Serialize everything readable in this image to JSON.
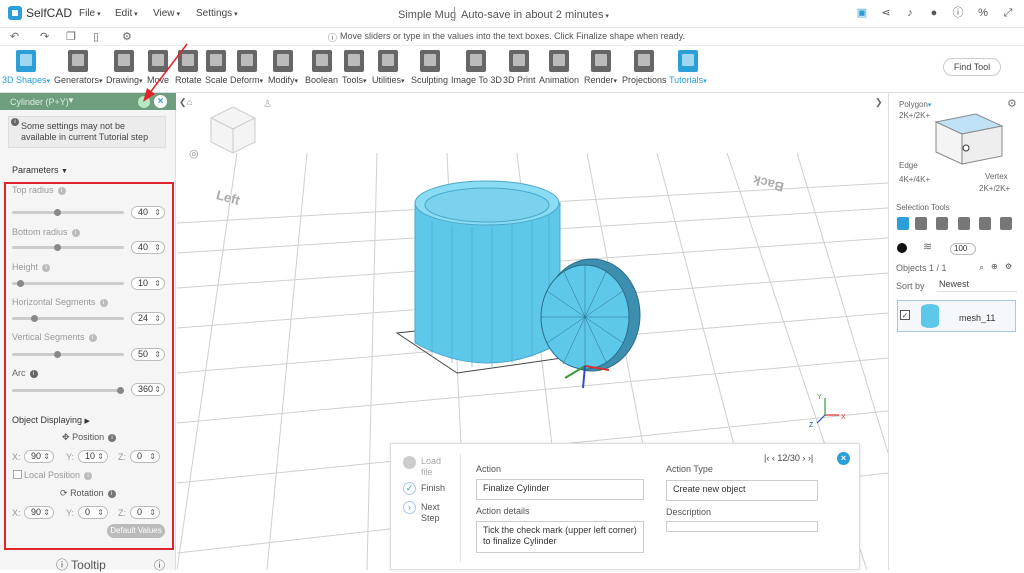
{
  "app": {
    "name": "SelfCAD"
  },
  "menu": [
    "File",
    "Edit",
    "View",
    "Settings"
  ],
  "document": {
    "title": "Simple Mug",
    "autosave": "Auto-save in about 2 minutes"
  },
  "hint": "Move sliders or type in the values into the text boxes. Click Finalize shape when ready.",
  "toolbar": {
    "tools": [
      {
        "label": "3D Shapes"
      },
      {
        "label": "Generators"
      },
      {
        "label": "Drawing"
      },
      {
        "label": "Move"
      },
      {
        "label": "Rotate"
      },
      {
        "label": "Scale"
      },
      {
        "label": "Deform"
      },
      {
        "label": "Modify"
      },
      {
        "label": "Boolean"
      },
      {
        "label": "Tools"
      },
      {
        "label": "Utilities"
      },
      {
        "label": "Sculpting"
      },
      {
        "label": "Image To 3D"
      },
      {
        "label": "3D Print"
      },
      {
        "label": "Animation"
      },
      {
        "label": "Render"
      },
      {
        "label": "Projections"
      },
      {
        "label": "Tutorials"
      }
    ],
    "find_tool": "Find Tool"
  },
  "panel": {
    "title": "Cylinder (P+Y)",
    "warning": "Some settings may not be available in current Tutorial step",
    "parameters_label": "Parameters",
    "params": [
      {
        "label": "Top radius",
        "value": "40",
        "fraction": 0.4
      },
      {
        "label": "Bottom radius",
        "value": "40",
        "fraction": 0.4
      },
      {
        "label": "Height",
        "value": "10",
        "fraction": 0.05
      },
      {
        "label": "Horizontal Segments",
        "value": "24",
        "fraction": 0.18
      },
      {
        "label": "Vertical Segments",
        "value": "50",
        "fraction": 0.4
      },
      {
        "label": "Arc",
        "value": "360",
        "fraction": 1.0
      }
    ],
    "object_displaying": "Object Displaying",
    "position_label": "Position",
    "position": {
      "x": "90",
      "y": "10",
      "z": "0"
    },
    "local_position": "Local Position",
    "rotation_label": "Rotation",
    "rotation": {
      "x": "90",
      "y": "0",
      "z": "0"
    },
    "axes": {
      "x": "X:",
      "y": "Y:",
      "z": "Z:"
    },
    "default_values": "Default Values",
    "tooltip": "Tooltip"
  },
  "viewport": {
    "label_left": "Left",
    "label_back": "Back"
  },
  "right": {
    "polygon": "Polygon",
    "polygon_keys": "2K+/2K+",
    "edge": "Edge",
    "edge_keys": "4K+/4K+",
    "vertex": "Vertex",
    "vertex_keys": "2K+/2K+",
    "selection_tools": "Selection Tools",
    "opacity": "100",
    "objects": "Objects 1 / 1",
    "sort_by": "Sort by",
    "sort_value": "Newest",
    "object_name": "mesh_11"
  },
  "tutorial": {
    "steps": [
      "Load file",
      "Finish",
      "Next Step"
    ],
    "action_label": "Action",
    "action_value": "Finalize Cylinder",
    "action_details_label": "Action details",
    "action_details_value": "Tick the check mark (upper left corner) to finalize Cylinder",
    "action_type_label": "Action Type",
    "action_type_value": "Create new object",
    "description_label": "Description",
    "description_value": "",
    "counter": "12/30"
  },
  "colors": {
    "accent": "#2a9fd8",
    "panel_header": "#6f9e7f",
    "highlight": "#e0242b",
    "mesh": "#5ec8ea"
  }
}
